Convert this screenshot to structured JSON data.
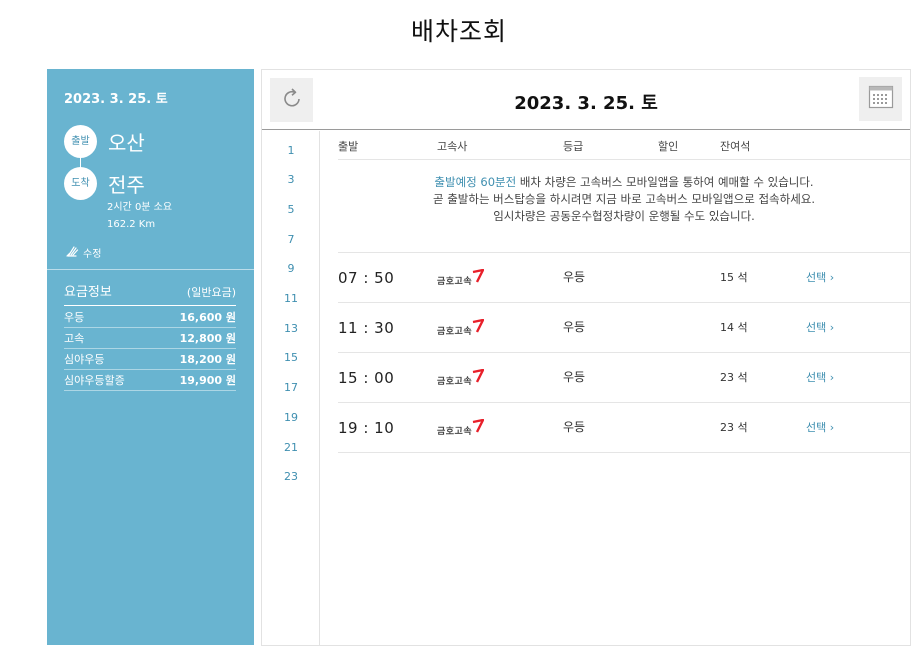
{
  "page": {
    "title": "배차조회"
  },
  "colors": {
    "panel": "#69b4d0",
    "accent": "#3f8fb0",
    "logo": "#e8202a"
  },
  "sidebar": {
    "date": "2023. 3. 25. 토",
    "departure_badge": "출발",
    "departure": "오산",
    "arrival_badge": "도착",
    "arrival": "전주",
    "duration": "2시간 0분 소요",
    "distance": "162.2 Km",
    "edit_label": "수정",
    "fare_title": "요금정보",
    "fare_type": "(일반요금)",
    "fares": [
      {
        "label": "우등",
        "value": "16,600 원"
      },
      {
        "label": "고속",
        "value": "12,800 원"
      },
      {
        "label": "심야우등",
        "value": "18,200 원"
      },
      {
        "label": "심야우등할증",
        "value": "19,900 원"
      }
    ]
  },
  "main": {
    "date": "2023. 3. 25. 토",
    "hours": [
      "1",
      "3",
      "5",
      "7",
      "9",
      "11",
      "13",
      "15",
      "17",
      "19",
      "21",
      "23"
    ],
    "columns": {
      "departure": "출발",
      "company": "고속사",
      "grade": "등급",
      "discount": "할인",
      "seats": "잔여석"
    },
    "notice": {
      "highlight": "출발예정 60분전",
      "line1_rest": " 배차 차량은 고속버스 모바일앱을 통하여 예매할 수 있습니다.",
      "line2": "곧 출발하는 버스탑승을 하시려면 지금 바로 고속버스 모바일앱으로 접속하세요.",
      "line3": "임시차량은 공동운수협정차량이 운행될 수도 있습니다."
    },
    "schedules": [
      {
        "time": "07 : 50",
        "company": "금호고속",
        "grade": "우등",
        "seats": "15 석",
        "select": "선택"
      },
      {
        "time": "11 : 30",
        "company": "금호고속",
        "grade": "우등",
        "seats": "14 석",
        "select": "선택"
      },
      {
        "time": "15 : 00",
        "company": "금호고속",
        "grade": "우등",
        "seats": "23 석",
        "select": "선택"
      },
      {
        "time": "19 : 10",
        "company": "금호고속",
        "grade": "우등",
        "seats": "23 석",
        "select": "선택"
      }
    ]
  }
}
